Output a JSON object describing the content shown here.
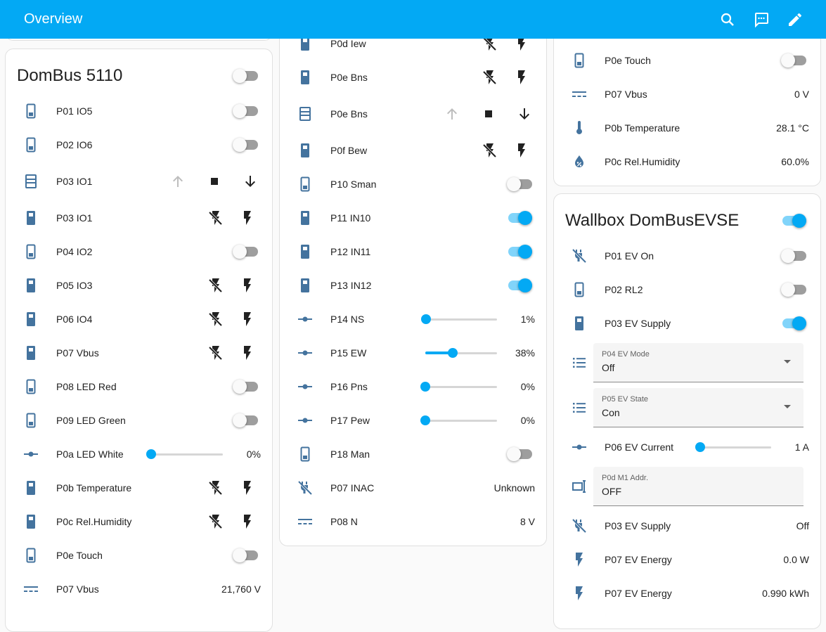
{
  "header": {
    "title": "Overview"
  },
  "colors": {
    "accent": "#03a9f4",
    "icon": "#44739e"
  },
  "col1": {
    "title": "DomBus 5110",
    "rows": {
      "r1": {
        "name": "P01 IO5"
      },
      "r2": {
        "name": "P02 IO6"
      },
      "r3": {
        "name": "P03 IO1"
      },
      "r4": {
        "name": "P03 IO1"
      },
      "r5": {
        "name": "P04 IO2"
      },
      "r6": {
        "name": "P05 IO3"
      },
      "r7": {
        "name": "P06 IO4"
      },
      "r8": {
        "name": "P07 Vbus"
      },
      "r9": {
        "name": "P08 LED Red"
      },
      "r10": {
        "name": "P09 LED Green"
      },
      "r11": {
        "name": "P0a LED White",
        "value": "0%",
        "level": 0
      },
      "r12": {
        "name": "P0b Temperature"
      },
      "r13": {
        "name": "P0c Rel.Humidity"
      },
      "r14": {
        "name": "P0e Touch"
      },
      "r15": {
        "name": "P07 Vbus",
        "state": "21,760 V"
      }
    }
  },
  "col2": {
    "rows": {
      "r1": {
        "name": "P0d Iew"
      },
      "r2": {
        "name": "P0e Bns"
      },
      "r3": {
        "name": "P0e Bns"
      },
      "r4": {
        "name": "P0f Bew"
      },
      "r5": {
        "name": "P10 Sman"
      },
      "r6": {
        "name": "P11 IN10"
      },
      "r7": {
        "name": "P12 IN11"
      },
      "r8": {
        "name": "P13 IN12"
      },
      "r9": {
        "name": "P14 NS",
        "value": "1%",
        "level": 1
      },
      "r10": {
        "name": "P15 EW",
        "value": "38%",
        "level": 38
      },
      "r11": {
        "name": "P16 Pns",
        "value": "0%",
        "level": 0
      },
      "r12": {
        "name": "P17 Pew",
        "value": "0%",
        "level": 0
      },
      "r13": {
        "name": "P18 Man"
      },
      "r14": {
        "name": "P07 INAC",
        "state": "Unknown"
      },
      "r15": {
        "name": "P08 N",
        "state": "8 V"
      }
    }
  },
  "col3a": {
    "rows": {
      "r1": {
        "name": "P0e Touch"
      },
      "r2": {
        "name": "P07 Vbus",
        "state": "0 V"
      },
      "r3": {
        "name": "P0b Temperature",
        "state": "28.1 °C"
      },
      "r4": {
        "name": "P0c Rel.Humidity",
        "state": "60.0%"
      }
    }
  },
  "col3b": {
    "title": "Wallbox DomBusEVSE",
    "rows": {
      "r1": {
        "name": "P01 EV On"
      },
      "r2": {
        "name": "P02 RL2"
      },
      "r3": {
        "name": "P03 EV Supply"
      },
      "r4": {
        "label": "P04 EV Mode",
        "value": "Off"
      },
      "r5": {
        "label": "P05 EV State",
        "value": "Con"
      },
      "r6": {
        "name": "P06 EV Current",
        "value": "1 A",
        "level": 1
      },
      "r7": {
        "label": "P0d M1 Addr.",
        "value": "OFF"
      },
      "r8": {
        "name": "P03 EV Supply",
        "state": "Off"
      },
      "r9": {
        "name": "P07 EV Energy",
        "state": "0.0 W"
      },
      "r10": {
        "name": "P07 EV Energy",
        "state": "0.990 kWh"
      }
    }
  }
}
